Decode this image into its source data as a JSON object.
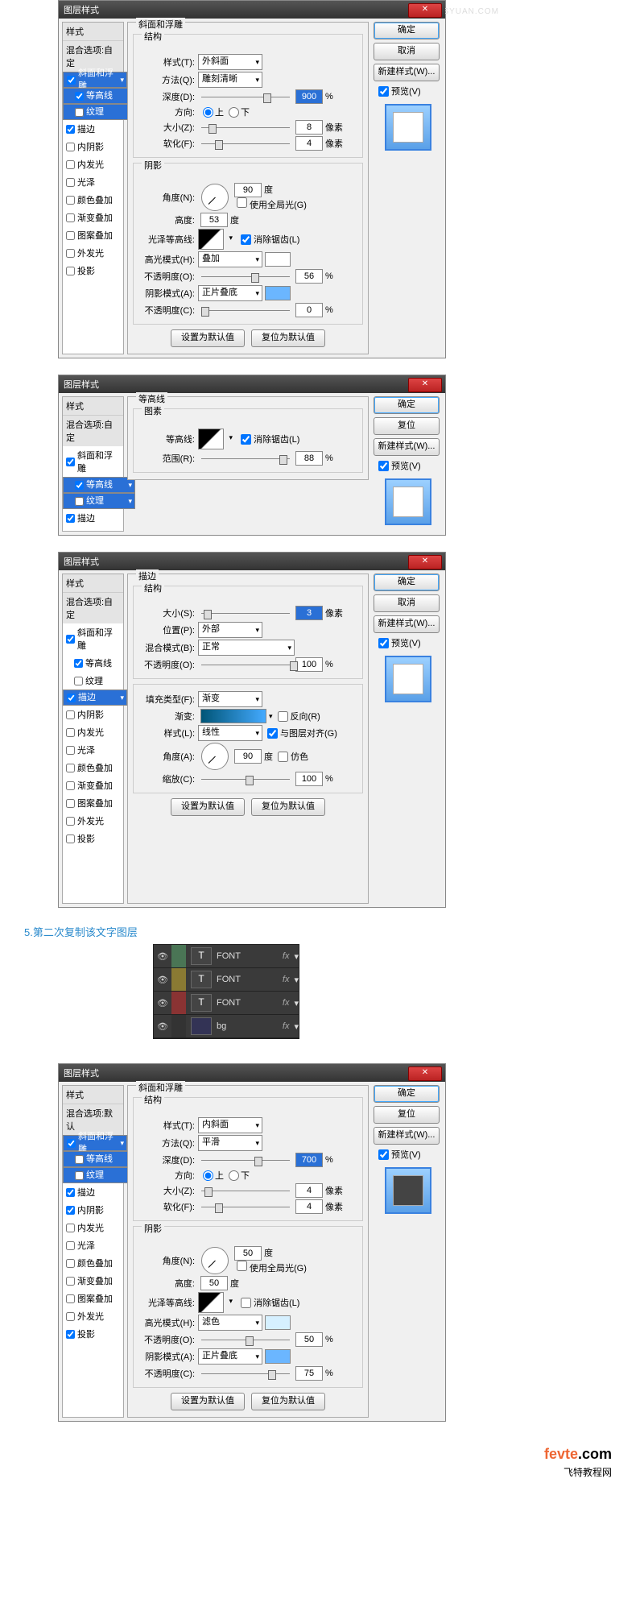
{
  "common": {
    "dlgtitle": "图层样式",
    "ok": "确定",
    "cancel": "取消",
    "reset": "复位",
    "newstyle": "新建样式(W)...",
    "preview": "预览(V)",
    "styles_head": "样式",
    "blend_custom": "混合选项:自定",
    "blend_default": "混合选项:默认",
    "setdefault": "设置为默认值",
    "resetdefault": "复位为默认值"
  },
  "stylenames": {
    "bevel": "斜面和浮雕",
    "contour": "等高线",
    "texture": "纹理",
    "stroke": "描边",
    "innershadow": "内阴影",
    "innerglow": "内发光",
    "satin": "光泽",
    "coloroverlay": "颜色叠加",
    "gradoverlay": "渐变叠加",
    "patternoverlay": "图案叠加",
    "outerglow": "外发光",
    "dropshadow": "投影"
  },
  "d1": {
    "panel_title": "斜面和浮雕",
    "struct": "结构",
    "shade": "阴影",
    "style_l": "样式(T):",
    "style_v": "外斜面",
    "tech_l": "方法(Q):",
    "tech_v": "雕刻清晰",
    "depth_l": "深度(D):",
    "depth_v": "900",
    "pct": "%",
    "dir_l": "方向:",
    "up": "上",
    "down": "下",
    "size_l": "大小(Z):",
    "size_v": "8",
    "px": "像素",
    "soft_l": "软化(F):",
    "soft_v": "4",
    "angle_l": "角度(N):",
    "angle_v": "90",
    "deg": "度",
    "useglobal": "使用全局光(G)",
    "alt_l": "高度:",
    "alt_v": "53",
    "gloss_l": "光泽等高线:",
    "anti": "消除锯齿(L)",
    "hmode_l": "高光模式(H):",
    "hmode_v": "叠加",
    "hop_l": "不透明度(O):",
    "hop_v": "56",
    "smode_l": "阴影模式(A):",
    "smode_v": "正片叠底",
    "sop_l": "不透明度(C):",
    "sop_v": "0"
  },
  "d2": {
    "panel_title": "等高线",
    "sec": "图素",
    "contour_l": "等高线:",
    "anti": "消除锯齿(L)",
    "range_l": "范围(R):",
    "range_v": "88",
    "pct": "%"
  },
  "d3": {
    "panel_title": "描边",
    "struct": "结构",
    "size_l": "大小(S):",
    "size_v": "3",
    "px": "像素",
    "pos_l": "位置(P):",
    "pos_v": "外部",
    "blend_l": "混合模式(B):",
    "blend_v": "正常",
    "op_l": "不透明度(O):",
    "op_v": "100",
    "pct": "%",
    "fill_l": "填充类型(F):",
    "fill_v": "渐变",
    "grad_l": "渐变:",
    "reverse": "反向(R)",
    "style_l": "样式(L):",
    "style_v": "线性",
    "align": "与图层对齐(G)",
    "angle_l": "角度(A):",
    "angle_v": "90",
    "deg": "度",
    "dither": "仿色",
    "scale_l": "缩放(C):",
    "scale_v": "100"
  },
  "step5": {
    "caption": "5.第二次复制该文字图层",
    "l1": "FONT",
    "l2": "FONT",
    "l3": "FONT",
    "l4": "bg",
    "T": "T",
    "fx": "fx"
  },
  "d4": {
    "panel_title": "斜面和浮雕",
    "struct": "结构",
    "shade": "阴影",
    "style_l": "样式(T):",
    "style_v": "内斜面",
    "tech_l": "方法(Q):",
    "tech_v": "平滑",
    "depth_l": "深度(D):",
    "depth_v": "700",
    "pct": "%",
    "dir_l": "方向:",
    "up": "上",
    "down": "下",
    "size_l": "大小(Z):",
    "size_v": "4",
    "px": "像素",
    "soft_l": "软化(F):",
    "soft_v": "4",
    "angle_l": "角度(N):",
    "angle_v": "50",
    "deg": "度",
    "useglobal": "使用全局光(G)",
    "alt_l": "高度:",
    "alt_v": "50",
    "gloss_l": "光泽等高线:",
    "anti": "消除锯齿(L)",
    "hmode_l": "高光模式(H):",
    "hmode_v": "滤色",
    "hop_l": "不透明度(O):",
    "hop_v": "50",
    "smode_l": "阴影模式(A):",
    "smode_v": "正片叠底",
    "sop_l": "不透明度(C):",
    "sop_v": "75"
  },
  "footer": {
    "brand_f": "fevte",
    "brand_c": ".com",
    "sub": "飞特教程网"
  },
  "wm": "思缘设计论坛  WWW.MISSYUAN.COM"
}
